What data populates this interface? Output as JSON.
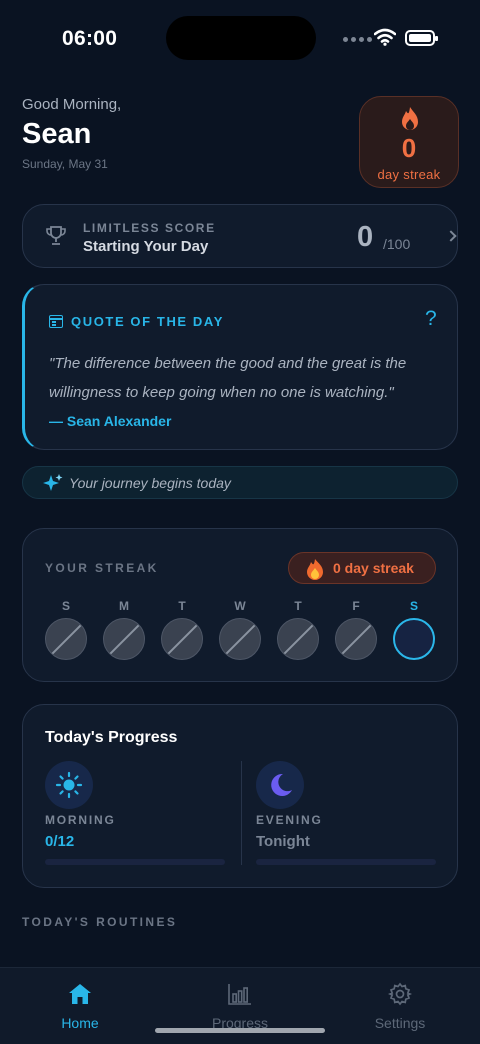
{
  "status_bar": {
    "time": "06:00"
  },
  "header": {
    "greeting": "Good Morning,",
    "name": "Sean",
    "date": "Sunday, May 31",
    "streak_count": "0",
    "streak_label": "day streak"
  },
  "score": {
    "label": "LIMITLESS SCORE",
    "subtitle": "Starting Your Day",
    "value": "0",
    "max": "/100"
  },
  "quote": {
    "title": "QUOTE OF THE DAY",
    "help": "?",
    "text": "\"The difference between the good and the great is the willingness to keep going when no one is watching.\"",
    "author": "— Sean Alexander"
  },
  "journey": {
    "text": "Your journey begins today"
  },
  "streak": {
    "title": "YOUR STREAK",
    "pill": "0 day streak",
    "days": [
      {
        "label": "S",
        "state": "missed"
      },
      {
        "label": "M",
        "state": "missed"
      },
      {
        "label": "T",
        "state": "missed"
      },
      {
        "label": "W",
        "state": "missed"
      },
      {
        "label": "T",
        "state": "missed"
      },
      {
        "label": "F",
        "state": "missed"
      },
      {
        "label": "S",
        "state": "today"
      }
    ]
  },
  "progress": {
    "title": "Today's Progress",
    "morning": {
      "label": "MORNING",
      "value": "0/12",
      "fraction": 0
    },
    "evening": {
      "label": "EVENING",
      "value": "Tonight",
      "fraction": 0
    }
  },
  "routines": {
    "title": "TODAY'S ROUTINES"
  },
  "tabs": [
    {
      "label": "Home",
      "icon": "home-icon",
      "active": true
    },
    {
      "label": "Progress",
      "icon": "bar-chart-icon",
      "active": false
    },
    {
      "label": "Settings",
      "icon": "gear-icon",
      "active": false
    }
  ],
  "colors": {
    "accent": "#29b6e8",
    "streak": "#f07043",
    "background": "#0a1322"
  }
}
